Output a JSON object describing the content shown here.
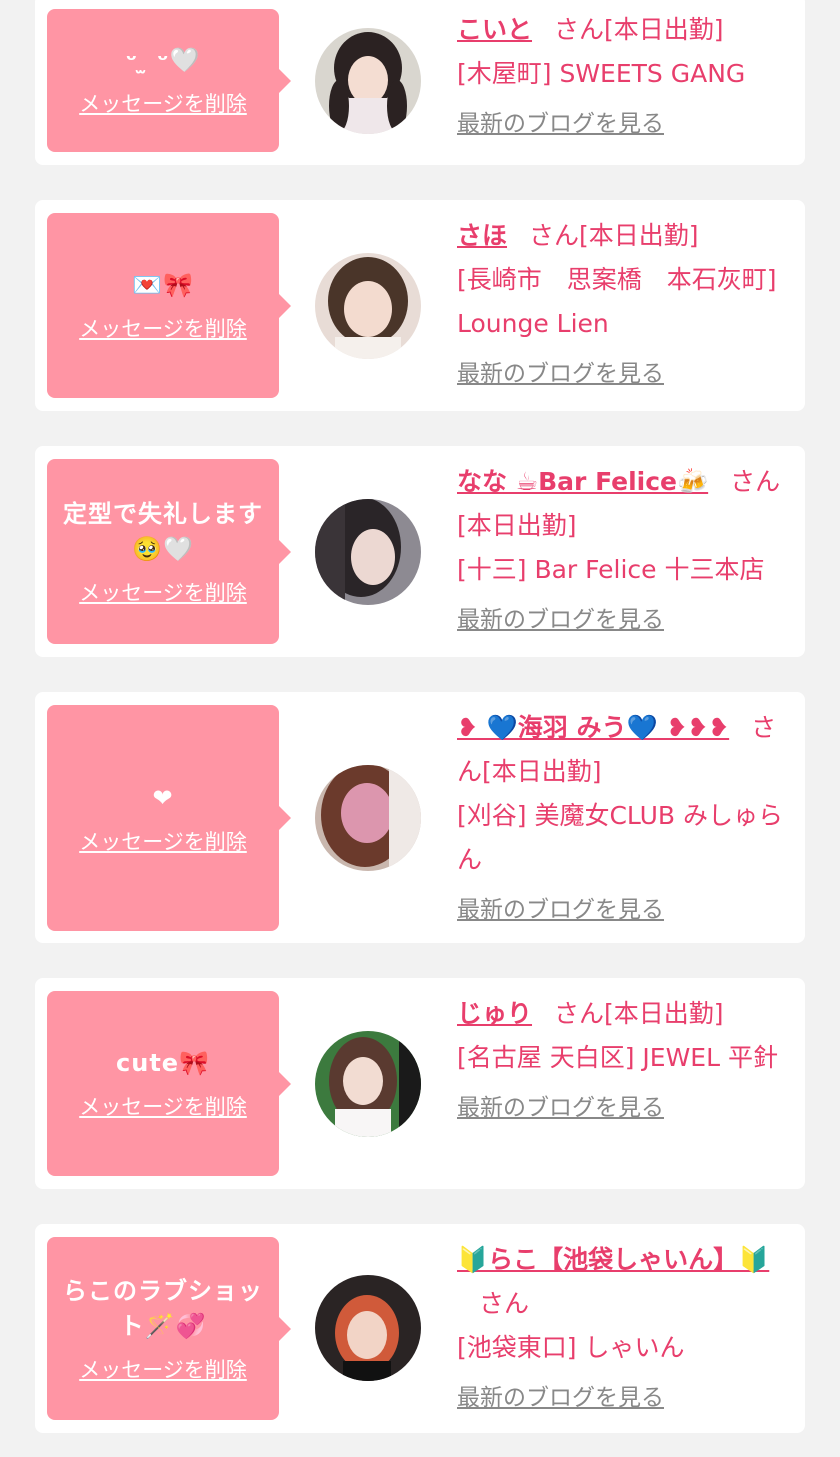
{
  "items": [
    {
      "message": "ᵕ ̫ ᵕ🤍",
      "delete_label": "メッセージを削除",
      "name": "こいと",
      "san": "さん",
      "status": "[本日出勤]",
      "shop": "[木屋町] SWEETS GANG",
      "blog_label": "最新のブログを見る"
    },
    {
      "message": "💌🎀",
      "delete_label": "メッセージを削除",
      "name": "さほ",
      "san": "さん",
      "status": "[本日出勤]",
      "shop": "[長崎市　思案橋　本石灰町] Lounge Lien",
      "blog_label": "最新のブログを見る"
    },
    {
      "message": "定型で失礼します🥹🤍",
      "delete_label": "メッセージを削除",
      "name": "なな ☕Bar Felice🍻",
      "san": "さん",
      "status": "[本日出勤]",
      "shop": "[十三] Bar Felice 十三本店",
      "blog_label": "最新のブログを見る"
    },
    {
      "message": "❤",
      "delete_label": "メッセージを削除",
      "name": "❥ 💙海羽 みう💙 ❥❥❥",
      "san": "さん",
      "status": "[本日出勤]",
      "shop": "[刈谷] 美魔女CLUB みしゅらん",
      "blog_label": "最新のブログを見る"
    },
    {
      "message": "cute🎀",
      "delete_label": "メッセージを削除",
      "name": "じゅり",
      "san": "さん",
      "status": "[本日出勤]",
      "shop": "[名古屋 天白区] JEWEL 平針",
      "blog_label": "最新のブログを見る"
    },
    {
      "message": "らこのラブショット🪄💞",
      "delete_label": "メッセージを削除",
      "name": "🔰らこ【池袋しゃいん】🔰",
      "san": "さん",
      "status": "",
      "shop": "[池袋東口] しゃいん",
      "blog_label": "最新のブログを見る"
    }
  ],
  "colors": {
    "accent": "#e83e6c",
    "bubble": "#ff95a4",
    "muted": "#888888",
    "background": "#f2f2f2"
  }
}
